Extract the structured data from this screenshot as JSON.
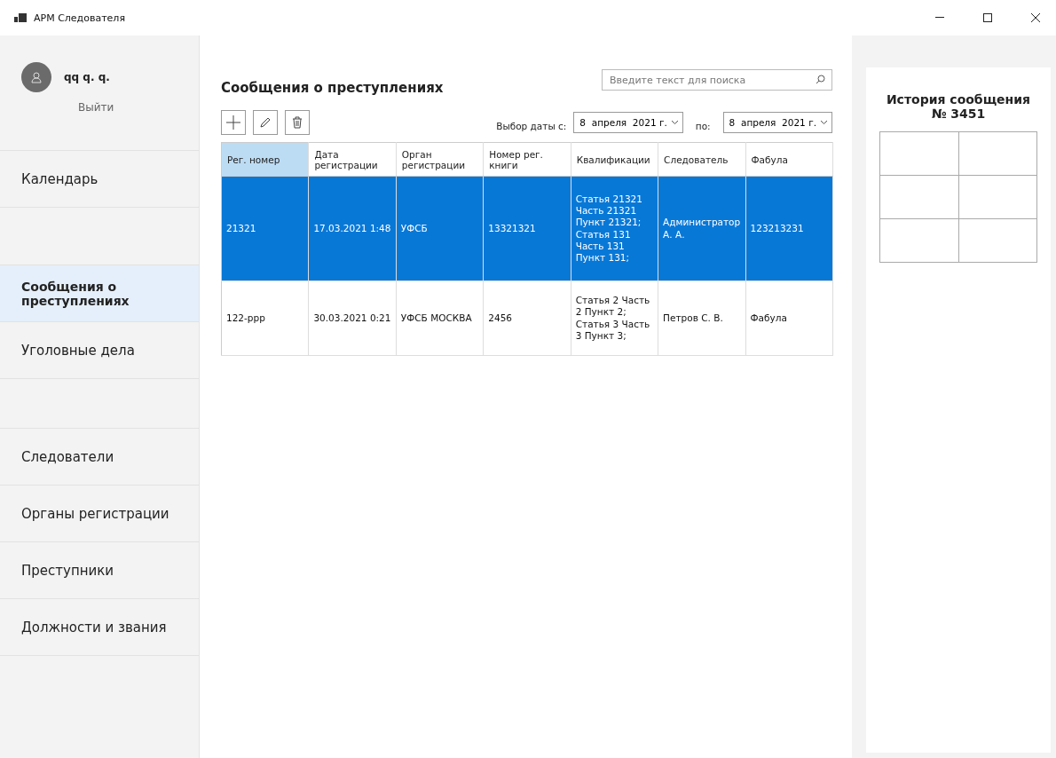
{
  "window": {
    "title": "АРМ Следователя"
  },
  "user": {
    "name": "qq q. q.",
    "logout": "Выйти"
  },
  "sidebar": {
    "items": [
      {
        "kind": "link",
        "label": "Календарь",
        "selected": false
      },
      {
        "kind": "spacer"
      },
      {
        "kind": "link",
        "label": "Сообщения о преступлениях",
        "selected": true
      },
      {
        "kind": "link",
        "label": "Уголовные дела",
        "selected": false
      },
      {
        "kind": "spacer"
      },
      {
        "kind": "link",
        "label": "Следователи",
        "selected": false
      },
      {
        "kind": "link",
        "label": "Органы регистрации",
        "selected": false
      },
      {
        "kind": "link",
        "label": "Преступники",
        "selected": false
      },
      {
        "kind": "link",
        "label": "Должности и звания",
        "selected": false
      }
    ]
  },
  "main": {
    "title": "Сообщения о преступлениях",
    "search": {
      "placeholder": "Введите текст для поиска"
    },
    "date_filter": {
      "label_from": "Выбор даты с:",
      "from": "8  апреля  2021 г.",
      "label_to": "по:",
      "to": "8  апреля  2021 г."
    },
    "table": {
      "columns": [
        {
          "label": "Рег. номер",
          "selected": true
        },
        {
          "label": "Дата регистрации",
          "selected": false
        },
        {
          "label": "Орган регистрации",
          "selected": false
        },
        {
          "label": "Номер рег. книги",
          "selected": false
        },
        {
          "label": "Квалификации",
          "selected": false
        },
        {
          "label": "Следователь",
          "selected": false
        },
        {
          "label": "Фабула",
          "selected": false
        }
      ],
      "rows": [
        {
          "selected": true,
          "cells": [
            "21321",
            "17.03.2021 1:48",
            "УФСБ",
            "13321321",
            "Статья 21321 Часть 21321 Пункт 21321; Статья 131 Часть 131 Пункт 131;",
            "Администратор А. А.",
            "123213231"
          ]
        },
        {
          "selected": false,
          "cells": [
            "122-ppp",
            "30.03.2021 0:21",
            "УФСБ МОСКВА",
            "2456",
            "Статья 2 Часть 2 Пункт 2; Статья 3 Часть 3 Пункт 3;",
            "Петров С. В.",
            "Фабула"
          ]
        }
      ]
    }
  },
  "history": {
    "title": "История сообщения № 3451"
  }
}
